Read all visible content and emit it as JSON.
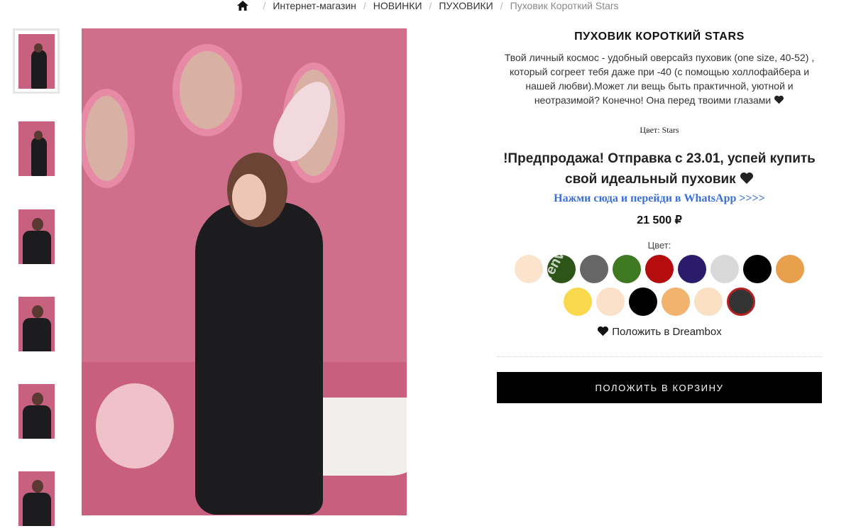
{
  "breadcrumb": {
    "home_icon": "home-icon",
    "items": [
      "Интернет-магазин",
      "НОВИНКИ",
      "ПУХОВИКИ",
      "Пуховик Короткий Stars"
    ]
  },
  "product": {
    "title": "ПУХОВИК КОРОТКИЙ STARS",
    "description": "Твой личный космос - удобный оверсайз пуховик (one size, 40-52) , который согреет тебя даже при -40 (с помощью холлофайбера и нашей любви).Может ли вещь быть практичной, уютной и неотразимой? Конечно! Она перед твоими глазами",
    "color_line": "Цвет: Stars",
    "presale": "!Предпродажа! Отправка с 23.01, успей купить свой идеальный пуховик",
    "whatsapp_link": "Нажми сюда и перейди в WhatsApp >>>>",
    "price": "21 500 ₽",
    "swatch_label": "Цвет:",
    "swatches": [
      "#fbe3cc",
      "#2f5419",
      "#666666",
      "#3f7a23",
      "#b50d0d",
      "#2b1b6b",
      "#d9d9d9",
      "#000000",
      "#e9a04d",
      "#f9d84d",
      "#fbe1c8",
      "#000000",
      "#f2b36e",
      "#fce0c3",
      "#333333"
    ],
    "selected_swatch_index": 14,
    "watermark_text": "ovarenv.ru",
    "dreambox_label": "Положить в Dreambox",
    "cart_button": "ПОЛОЖИТЬ В КОРЗИНУ"
  },
  "gallery": {
    "thumbnail_count": 6,
    "active_thumbnail": 0
  },
  "colors": {
    "accent_link": "#3b6fd6",
    "button_bg": "#000000",
    "selected_border": "#b51f1f"
  }
}
